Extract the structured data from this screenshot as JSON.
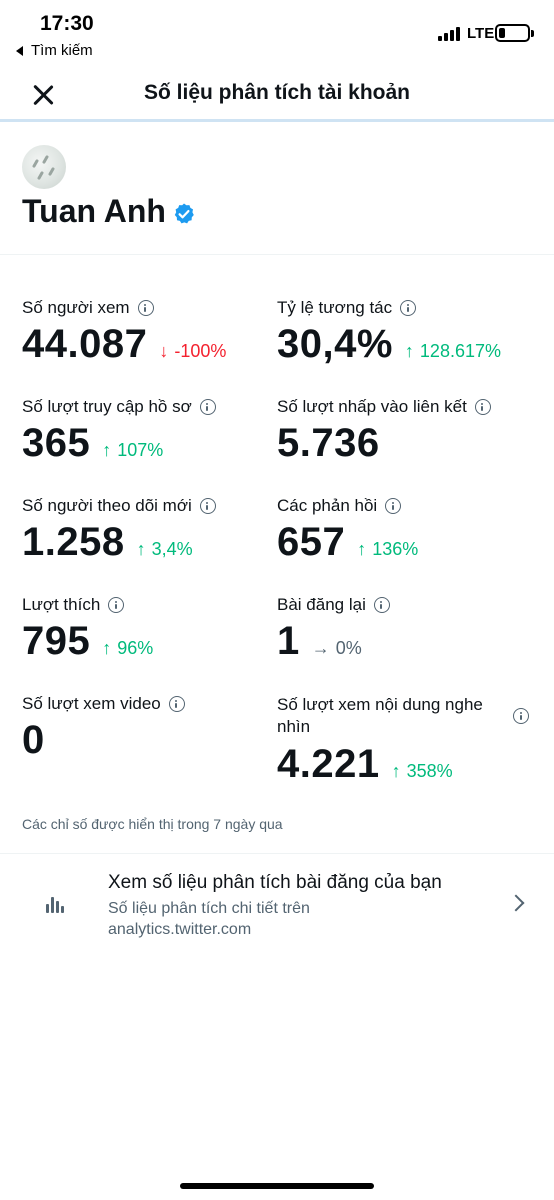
{
  "status_bar": {
    "time": "17:30",
    "back_label": "Tìm kiếm",
    "network": "LTE"
  },
  "header": {
    "title": "Số liệu phân tích tài khoản",
    "close_icon": "close-icon"
  },
  "profile": {
    "name": "Tuan Anh",
    "verified_icon": "verified-badge-icon",
    "verified_color": "#1d9bf0"
  },
  "metrics": [
    {
      "label": "Số người xem",
      "value": "44.087",
      "change": "-100%",
      "direction": "down"
    },
    {
      "label": "Tỷ lệ tương tác",
      "value": "30,4%",
      "change": "128.617%",
      "direction": "up"
    },
    {
      "label": "Số lượt truy cập hồ sơ",
      "value": "365",
      "change": "107%",
      "direction": "up"
    },
    {
      "label": "Số lượt nhấp vào liên kết",
      "value": "5.736",
      "change": "",
      "direction": "none"
    },
    {
      "label": "Số người theo dõi mới",
      "value": "1.258",
      "change": "3,4%",
      "direction": "up"
    },
    {
      "label": "Các phản hồi",
      "value": "657",
      "change": "136%",
      "direction": "up"
    },
    {
      "label": "Lượt thích",
      "value": "795",
      "change": "96%",
      "direction": "up"
    },
    {
      "label": "Bài đăng lại",
      "value": "1",
      "change": "0%",
      "direction": "flat"
    },
    {
      "label": "Số lượt xem video",
      "value": "0",
      "change": "",
      "direction": "none"
    },
    {
      "label": "Số lượt xem nội dung nghe nhìn",
      "value": "4.221",
      "change": "358%",
      "direction": "up"
    }
  ],
  "footnote": "Các chỉ số được hiển thị trong 7 ngày qua",
  "analytics_link": {
    "title": "Xem số liệu phân tích bài đăng của bạn",
    "subtitle": "Số liệu phân tích chi tiết trên analytics.twitter.com",
    "icon": "bar-chart-icon"
  },
  "colors": {
    "up": "#00ba7c",
    "down": "#f4212e",
    "flat": "#536471",
    "accent_line": "#cfe3f3"
  }
}
